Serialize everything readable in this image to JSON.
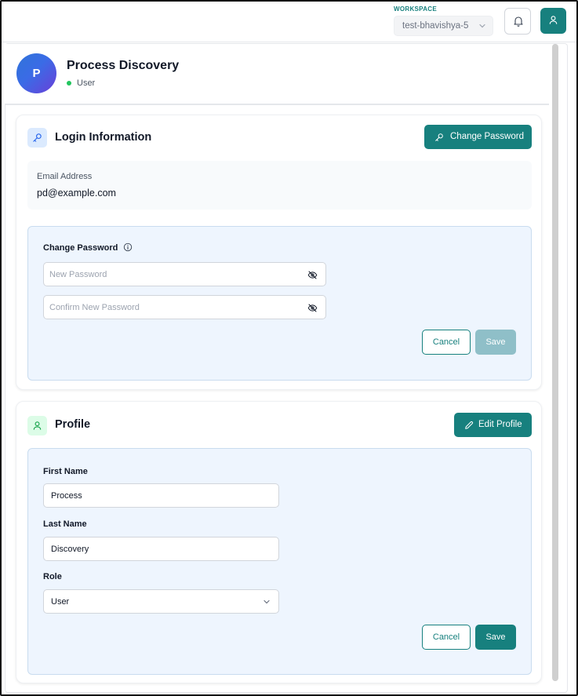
{
  "topbar": {
    "workspace_label": "WORKSPACE",
    "workspace_value": "test-bhavishya-5"
  },
  "user": {
    "initial": "P",
    "name": "Process Discovery",
    "role": "User"
  },
  "login": {
    "title": "Login Information",
    "change_password_button": "Change Password",
    "email_label": "Email Address",
    "email_value": "pd@example.com",
    "change_password_panel": {
      "title": "Change Password",
      "new_password_placeholder": "New Password",
      "confirm_password_placeholder": "Confirm New Password",
      "cancel_label": "Cancel",
      "save_label": "Save"
    }
  },
  "profile": {
    "title": "Profile",
    "edit_button": "Edit Profile",
    "first_name_label": "First Name",
    "first_name_value": "Process",
    "last_name_label": "Last Name",
    "last_name_value": "Discovery",
    "role_label": "Role",
    "role_value": "User",
    "cancel_label": "Cancel",
    "save_label": "Save"
  },
  "colors": {
    "accent": "#17807e",
    "status_online": "#22c55e",
    "panel_bg": "#eef5fe",
    "disabled_button": "#8fbfc8"
  },
  "icons": [
    "chevron-down-icon",
    "bell-icon",
    "user-icon",
    "key-icon",
    "pencil-icon",
    "info-icon",
    "eye-off-icon"
  ]
}
